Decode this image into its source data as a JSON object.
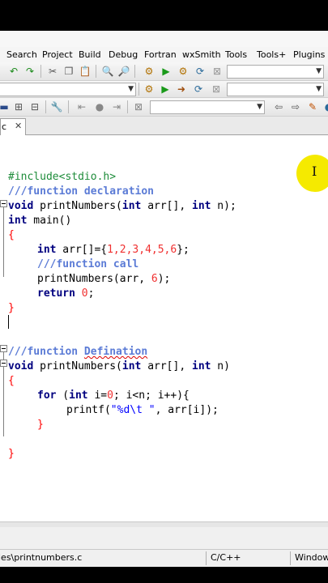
{
  "menu": [
    "Search",
    "Project",
    "Build",
    "Debug",
    "Fortran",
    "wxSmith",
    "Tools",
    "Tools+",
    "Plugins"
  ],
  "editor_tab": {
    "label": "c",
    "close": "✕"
  },
  "code": {
    "l1": "#include<stdio.h>",
    "l2": "///function declaration",
    "l3_kw": "void",
    "l3_a": " printNumbers(",
    "l3_kw2": "int",
    "l3_b": " arr[], ",
    "l3_kw3": "int",
    "l3_c": " n);",
    "l4_kw": "int",
    "l4_a": " main()",
    "l5": "{",
    "l6_kw": "int",
    "l6_a": " arr[]={",
    "l6_nums": "1,2,3,4,5,6",
    "l6_b": "};",
    "l7": "///function call",
    "l8_a": "printNumbers(arr, ",
    "l8_num": "6",
    "l8_b": ");",
    "l9_kw": "return",
    "l9_num": " 0",
    "l9_b": ";",
    "l10": "}",
    "l12_a": "///function ",
    "l12_b": "Defination",
    "l13_kw": "void",
    "l13_a": " printNumbers(",
    "l13_kw2": "int",
    "l13_b": " arr[], ",
    "l13_kw3": "int",
    "l13_c": " n)",
    "l14": "{",
    "l15_kw": "for",
    "l15_a": " (",
    "l15_kw2": "int",
    "l15_b": " i=",
    "l15_num": "0",
    "l15_c": "; i<n; i++){",
    "l16_a": "printf(",
    "l16_str": "\"%d\\t \"",
    "l16_b": ", arr[i]);",
    "l17": "}",
    "l19": "}"
  },
  "status": {
    "file": "les\\printnumbers.c",
    "lang": "C/C++",
    "eol": "Windows"
  },
  "colors": {
    "cursor_highlight": "#f5ea00",
    "keyword": "#00007f",
    "comment": "#5b7bd6",
    "preprocessor": "#1e8c3a"
  }
}
